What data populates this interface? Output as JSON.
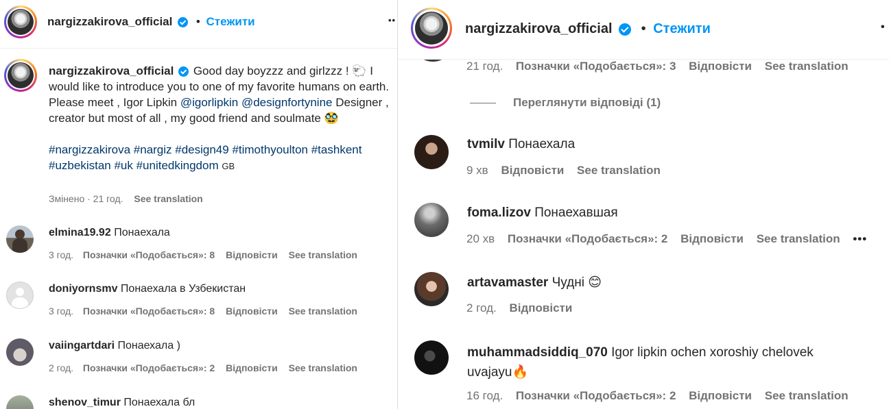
{
  "left": {
    "header": {
      "username": "nargizzakirova_official",
      "separator": "•",
      "follow_label": "Стежити",
      "more_label": "••"
    },
    "caption": {
      "username": "nargizzakirova_official",
      "text_1": "Good day boyzzz and girlzzz !",
      "emoji_1": "🐑",
      "text_2": "I would like to introduce you to one of my favorite humans on earth. Please meet , Igor Lipkin",
      "mention_1": "@igorlipkin",
      "mention_2": "@designfortynine",
      "text_3": "Designer , creator but most of all , my good friend and soulmate",
      "emoji_2": "🥸",
      "hashtags_line1": "#nargizzakirova #nargiz #design49 #timothyoulton #tashkent",
      "hashtags_line2": "#uzbekistan #uk #unitedkingdom",
      "flag": "GB",
      "edited_label": "Змінено · 21 год.",
      "translation_label": "See translation"
    },
    "comments": [
      {
        "username": "elmina19.92",
        "text": "Понаехала",
        "time": "3 год.",
        "likes": "Позначки «Подобається»: 8",
        "reply": "Відповісти",
        "translate": "See translation"
      },
      {
        "username": "doniyornsmv",
        "text": "Понаехала в Узбекистан",
        "time": "3 год.",
        "likes": "Позначки «Подобається»: 8",
        "reply": "Відповісти",
        "translate": "See translation"
      },
      {
        "username": "vaiingartdari",
        "text": "Понаехала )",
        "time": "2 год.",
        "likes": "Позначки «Подобається»: 2",
        "reply": "Відповісти",
        "translate": "See translation"
      },
      {
        "username": "shenov_timur",
        "text": "Понаехала бл"
      }
    ]
  },
  "right": {
    "header": {
      "username": "nargizzakirova_official",
      "separator": "•",
      "follow_label": "Стежити",
      "more_label": "•"
    },
    "top_meta": {
      "time": "21 год.",
      "likes": "Позначки «Подобається»: 3",
      "reply": "Відповісти",
      "translate": "See translation"
    },
    "view_replies_label": "Переглянути відповіді (1)",
    "comments": [
      {
        "username": "tvmilv",
        "text": "Понаехала",
        "time": "9 хв",
        "reply": "Відповісти",
        "translate": "See translation"
      },
      {
        "username": "foma.lizov",
        "text": "Понаехавшая",
        "time": "20 хв",
        "likes": "Позначки «Подобається»: 2",
        "reply": "Відповісти",
        "translate": "See translation",
        "more": "•••"
      },
      {
        "username": "artavamaster",
        "text": "Чудні",
        "emoji": "😊",
        "time": "2 год.",
        "reply": "Відповісти"
      },
      {
        "username": "muhammadsiddiq_070",
        "text_1": "Igor lipkin ochen xoroshiy chelovek",
        "text_2": "uvajayu",
        "emoji": "🔥",
        "time": "16 год.",
        "likes": "Позначки «Подобається»: 2",
        "reply": "Відповісти",
        "translate": "See translation"
      }
    ]
  },
  "colors": {
    "accent": "#0095f6",
    "muted": "#737373",
    "text": "#262626",
    "link": "#00376b"
  }
}
